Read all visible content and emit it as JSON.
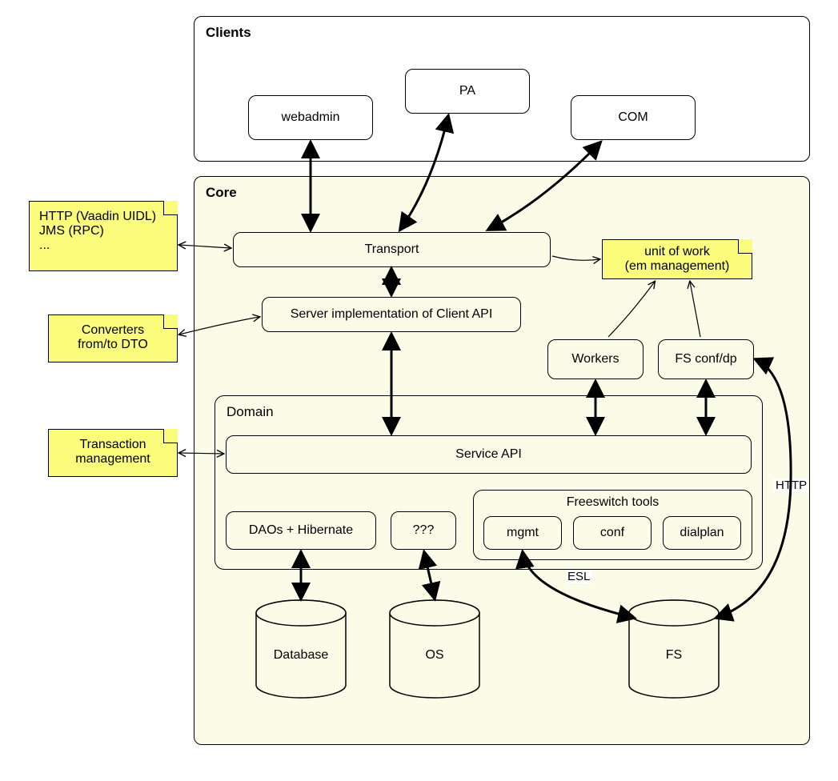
{
  "groups": {
    "clients": "Clients",
    "core": "Core",
    "domain": "Domain",
    "freeswitch_tools": "Freeswitch tools"
  },
  "clients": {
    "webadmin": "webadmin",
    "pa": "PA",
    "com": "COM"
  },
  "core": {
    "transport": "Transport",
    "server_impl": "Server implementation of Client API",
    "workers": "Workers",
    "fs_conf_dp": "FS conf/dp"
  },
  "domain": {
    "service_api": "Service API",
    "daos": "DAOs + Hibernate",
    "unknown": "???",
    "mgmt": "mgmt",
    "conf": "conf",
    "dialplan": "dialplan"
  },
  "cylinders": {
    "database": "Database",
    "os": "OS",
    "fs": "FS"
  },
  "notes": {
    "http_note_line1": "HTTP (Vaadin UIDL)",
    "http_note_line2": "JMS (RPC)",
    "http_note_line3": "...",
    "converters_line1": "Converters",
    "converters_line2": "from/to DTO",
    "transaction_line1": "Transaction",
    "transaction_line2": "management",
    "unit_of_work_line1": "unit of work",
    "unit_of_work_line2": "(em management)"
  },
  "edge_labels": {
    "esl": "ESL",
    "http": "HTTP"
  }
}
